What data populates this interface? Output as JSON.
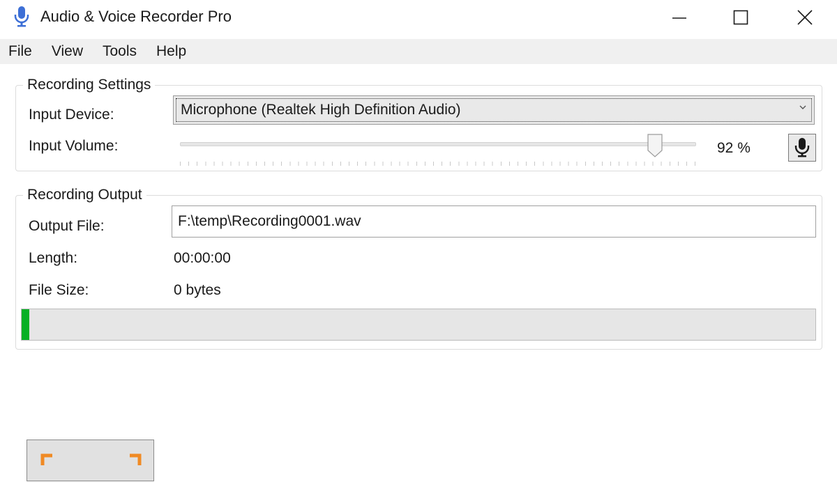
{
  "window": {
    "title": "Audio & Voice Recorder Pro",
    "icon": "microphone-icon"
  },
  "menu": {
    "items": [
      "File",
      "View",
      "Tools",
      "Help"
    ]
  },
  "recording_settings": {
    "title": "Recording Settings",
    "input_device_label": "Input Device:",
    "input_device_value": "Microphone (Realtek High Definition Audio)",
    "input_volume_label": "Input Volume:",
    "input_volume_percent": 92,
    "input_volume_text": "92 %"
  },
  "recording_output": {
    "title": "Recording Output",
    "output_file_label": "Output File:",
    "output_file_value": "F:\\temp\\Recording0001.wav",
    "length_label": "Length:",
    "length_value": "00:00:00",
    "file_size_label": "File Size:",
    "file_size_value": "0 bytes",
    "level_fraction": 0.01
  },
  "colors": {
    "accent_icon": "#3d6fd6",
    "level_green": "#06b025",
    "record_corner": "#f08a24"
  }
}
